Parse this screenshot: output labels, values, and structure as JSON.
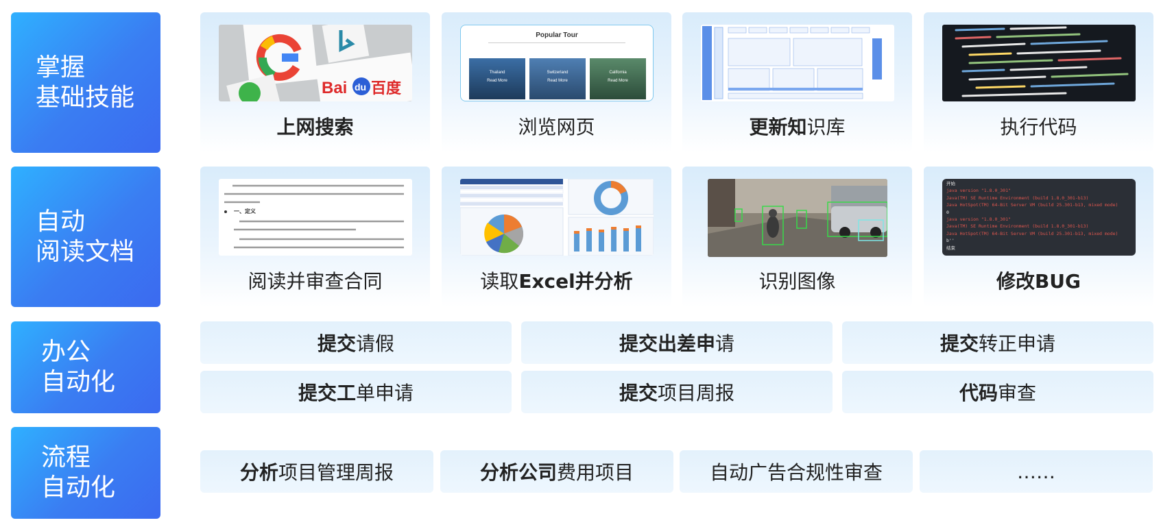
{
  "categories": [
    {
      "line1": "掌握",
      "line2": "基础技能"
    },
    {
      "line1": "自动",
      "line2": "阅读文档"
    },
    {
      "line1": "办公",
      "line2": "自动化"
    },
    {
      "line1": "流程",
      "line2": "自动化"
    }
  ],
  "basic_skills": [
    {
      "label": "上网搜索"
    },
    {
      "label": "浏览网页",
      "thumb_title": "Popular Tour",
      "thumb_cities": [
        "Thailand",
        "Switzerland",
        "California"
      ],
      "thumb_link": "Read More"
    },
    {
      "label_bold": "更新知",
      "label_rest": "识库"
    },
    {
      "label": "执行代码"
    }
  ],
  "read_docs": [
    {
      "label": "阅读并审查合同",
      "thumb_heading": "一、定义"
    },
    {
      "label_rest": "读取",
      "label_bold": "Excel并分析"
    },
    {
      "label": "识别图像"
    },
    {
      "label": "修改BUG",
      "thumb_lines": [
        "开始",
        "java version \"1.8.0_301\"",
        "Java(TM) SE Runtime Environment (build 1.8.0_301-b13)",
        "Java HotSpot(TM) 64-Bit Server VM (build 25.301-b13, mixed mode)",
        "0",
        "java version \"1.8.0_301\"",
        "Java(TM) SE Runtime Environment (build 1.8.0_301-b13)",
        "Java HotSpot(TM) 64-Bit Server VM (build 25.301-b13, mixed mode)",
        "b''",
        "结束"
      ]
    }
  ],
  "office": [
    {
      "bold": "提交",
      "rest": "请假"
    },
    {
      "bold": "提交出差申",
      "rest": "请"
    },
    {
      "bold": "提交",
      "rest": "转正申请"
    },
    {
      "bold": "提交工",
      "rest": "单申请"
    },
    {
      "bold": "提交",
      "rest": "项目周报"
    },
    {
      "bold": "代码",
      "rest": "审查"
    }
  ],
  "process": [
    {
      "bold": "分析",
      "rest": "项目管理周报"
    },
    {
      "bold": "分析公司",
      "rest": "费用项目"
    },
    {
      "bold": "",
      "rest": "自动广告合规性审查"
    },
    {
      "bold": "",
      "rest": "……"
    }
  ],
  "colors": {
    "category_start": "#2fb0ff",
    "category_end": "#3b6af0",
    "card_top": "#d9ecfb",
    "pill": "#e3f1fc"
  }
}
